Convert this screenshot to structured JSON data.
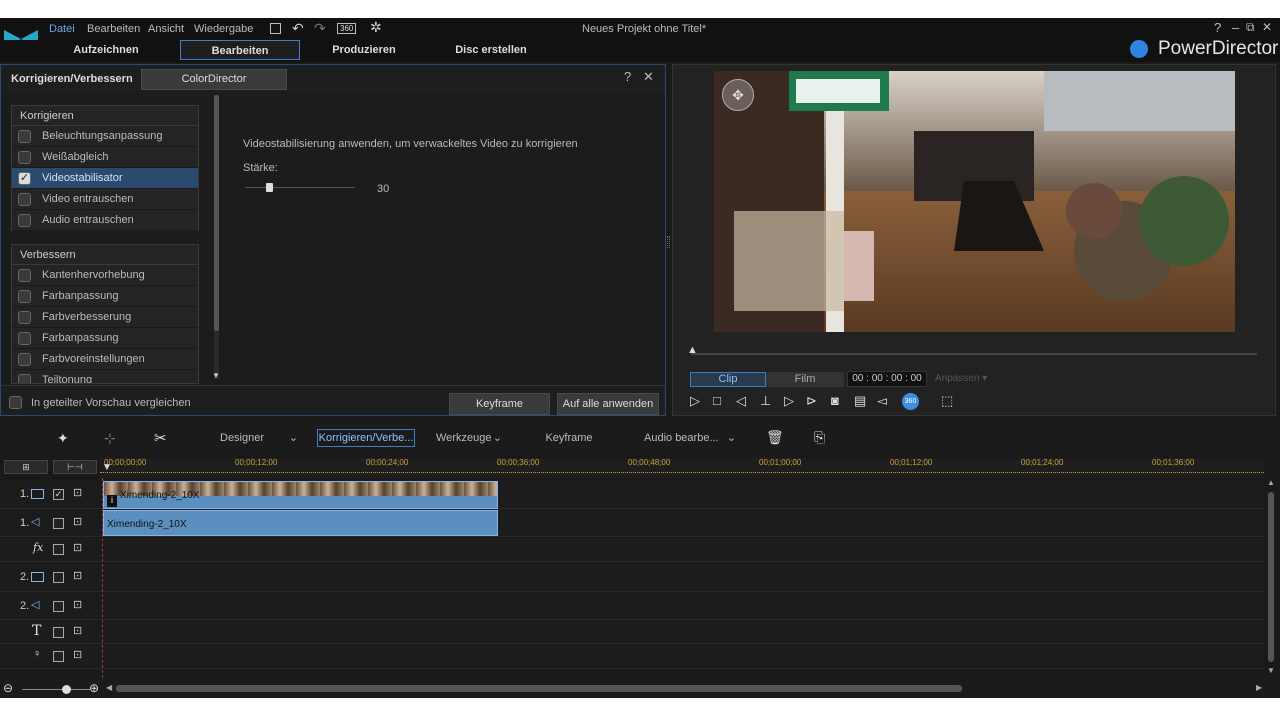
{
  "window": {
    "title": "Neues Projekt ohne Titel*",
    "app_name": "PowerDirector"
  },
  "menu": [
    "Datei",
    "Bearbeiten",
    "Ansicht",
    "Wiedergabe"
  ],
  "toolbar_icons": {
    "save": "save-icon",
    "undo": "undo-icon",
    "redo": "redo-icon",
    "vr": "360",
    "settings": "gear-icon"
  },
  "window_controls": {
    "help": "?",
    "min": "–",
    "max": "⧉",
    "close": "✕"
  },
  "modes": [
    "Aufzeichnen",
    "Bearbeiten",
    "Produzieren",
    "Disc erstellen"
  ],
  "active_mode": "Bearbeiten",
  "fix_panel": {
    "title": "Korrigieren/Verbessern",
    "tab": "ColorDirector",
    "help": "?",
    "close": "✕",
    "section1": "Korrigieren",
    "items1": [
      "Beleuchtungsanpassung",
      "Weißabgleich",
      "Videostabilisator",
      "Video entrauschen",
      "Audio entrauschen"
    ],
    "section2": "Verbessern",
    "items2": [
      "Kantenhervorhebung",
      "Farbanpassung",
      "Farbverbesserung",
      "Farbanpassung",
      "Farbvoreinstellungen",
      "Teiltonung"
    ],
    "selected": "Videostabilisator",
    "description": "Videostabilisierung anwenden, um verwackeltes Video zu korrigieren",
    "strength_label": "Stärke:",
    "strength_value": "30",
    "strength_level": 0.22,
    "compare_label": "In geteilter Vorschau vergleichen",
    "keyframe_btn": "Keyframe",
    "apply_all_btn": "Auf alle anwenden"
  },
  "preview": {
    "clip_tab": "Clip",
    "film_tab": "Film",
    "timecode": "00 : 00 : 00 : 00",
    "adjust": "Anpassen"
  },
  "timeline_toolbar": {
    "designer": "Designer",
    "fix": "Korrigieren/Verbe...",
    "tools": "Werkzeuge",
    "keyframe": "Keyframe",
    "audio": "Audio bearbe..."
  },
  "ruler": [
    "00;00;00;00",
    "00;00;12;00",
    "00;00;24;00",
    "00;00;36;00",
    "00;00;48;00",
    "00;01;00;00",
    "00;01;12;00",
    "00;01;24;00",
    "00;01;36;00"
  ],
  "tracks": [
    {
      "label": "1.",
      "icon": "video-track-icon",
      "clip": "Ximending-2_10X"
    },
    {
      "label": "1.",
      "icon": "audio-track-icon",
      "clip": "Ximending-2_10X"
    },
    {
      "label": "",
      "icon": "fx-track-icon",
      "clip": ""
    },
    {
      "label": "2.",
      "icon": "video-track-icon",
      "clip": ""
    },
    {
      "label": "2.",
      "icon": "audio-track-icon",
      "clip": ""
    },
    {
      "label": "",
      "icon": "title-track-icon",
      "clip": ""
    },
    {
      "label": "",
      "icon": "voice-track-icon",
      "clip": ""
    }
  ],
  "colors": {
    "accent": "#3a7fc8",
    "clip": "#5a8fbf",
    "ruler": "#c9a23a"
  }
}
